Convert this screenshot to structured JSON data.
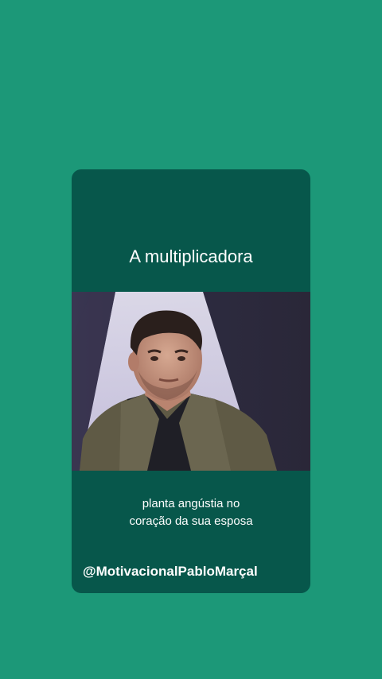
{
  "card": {
    "title": "A multiplicadora",
    "caption_line1": "planta angústia no",
    "caption_line2": "coração da sua esposa",
    "handle": "@MotivacionalPabloMarçal"
  },
  "colors": {
    "page_background": "#1c9878",
    "card_background": "#07574b",
    "text": "#ffffff"
  }
}
